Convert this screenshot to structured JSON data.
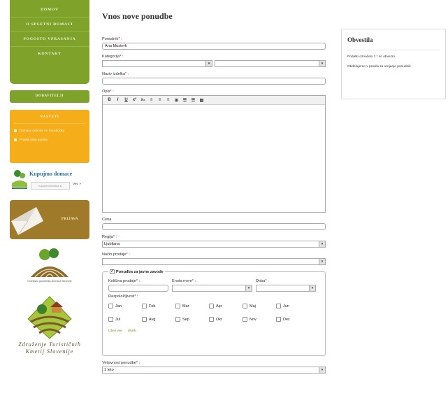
{
  "sidebar": {
    "nav": [
      "DOMOV",
      "O SPLETNI DOMACI",
      "POGOSTO VPRASANJA",
      "KONTAKT"
    ],
    "submit_button": "DOBAVITELJI",
    "orange_box": {
      "title": "NASVETI",
      "items": [
        "Domace dobrote na Facebooku",
        "Pravila rabe portala"
      ]
    },
    "kupujmo": {
      "title": "Kupujmo domace",
      "box_text": "kupujmodomace.si",
      "more": "Vec »"
    },
    "brown_banner": "PRIJAVA",
    "logo1_text": "Kmetijsko gozdarska zbornica Slovenije",
    "logo2_text": "Združenje Turističnih Kmetij Slovenije"
  },
  "main": {
    "title": "Vnos nove ponudbe",
    "fields": {
      "ponudnik": {
        "label": "Ponudnik",
        "value": "Ana Musterk"
      },
      "kategorija": {
        "label": "Kategorija",
        "value1": "",
        "value2": ""
      },
      "naziv": {
        "label": "Naziv izdelka",
        "value": ""
      },
      "opis": {
        "label": "Opis"
      },
      "cena": {
        "label": "Cena",
        "value": ""
      },
      "regija": {
        "label": "Regija",
        "value": "Ljubljana"
      },
      "nacin": {
        "label": "Način prodaje",
        "value": ""
      },
      "veljavnost": {
        "label": "Veljavnost ponudbe",
        "value": "1 leto"
      }
    },
    "toolbar": [
      "B",
      "I",
      "U",
      "x²",
      "x₂",
      "≡",
      "≡",
      "≡",
      "⊞",
      "☰",
      "☰",
      "▤"
    ],
    "javni_zavodi": {
      "legend": "Ponudba za javne zavode",
      "kolicina": {
        "label": "Količina prodaje",
        "value": ""
      },
      "enota": {
        "label": "Enota mere",
        "value": ""
      },
      "doba": {
        "label": "Doba",
        "value": ""
      },
      "razpolozljivost_label": "Razpoložljivost",
      "months": [
        "Jan",
        "Feb",
        "Mar",
        "Apr",
        "Maj",
        "Jun",
        "Jul",
        "Avg",
        "Sep",
        "Okt",
        "Nov",
        "Dec"
      ],
      "select_all": "Izberi vse",
      "clear_all": "Izbriši"
    }
  },
  "notice": {
    "title": "Obvestila",
    "p1": "Podatki označeni z * so obvezni.",
    "p2": "Obdelujemo v pravila za urejanje ponudnik."
  }
}
